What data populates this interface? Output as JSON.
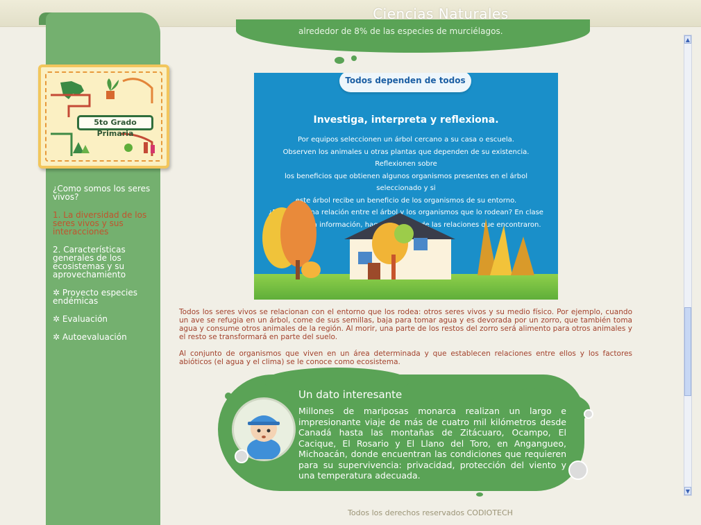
{
  "app_title": "Ciencias Naturales",
  "logo": {
    "label": "5to Grado Primaria",
    "icon": "mexico-map-icon"
  },
  "sidebar": {
    "items": [
      {
        "label": "¿Como somos los seres vivos?",
        "bullet": ""
      },
      {
        "label": "1. La diversidad de los seres vivos y sus interacciones",
        "bullet": "",
        "active": true
      },
      {
        "label": "2. Características generales de los ecosistemas y su aprovechamiento",
        "bullet": ""
      },
      {
        "label": "Proyecto especies endémicas",
        "bullet": "✲"
      },
      {
        "label": "Evaluación",
        "bullet": "✲"
      },
      {
        "label": "Autoevaluación",
        "bullet": "✲"
      }
    ]
  },
  "top_cloud_text": "alrededor de 8% de las especies de murciélagos.",
  "panel": {
    "badge": "Todos dependen de todos",
    "heading": "Investiga, interpreta y reflexiona.",
    "lines": [
      "Por equipos seleccionen un árbol cercano a su casa o escuela.",
      "Observen los animales u otras plantas que dependen de su existencia. Reflexionen sobre",
      "los beneficios que obtienen algunos organismos presentes en el árbol seleccionado y si",
      "este árbol recibe un beneficio de los organismos de su entorno.",
      "¿Existe alguna relación entre el árbol y los organismos que lo rodean? En clase",
      "comparten la información, hagan una lista de las relaciones que encontraron."
    ]
  },
  "intro": {
    "p1": "Todos los seres vivos se relacionan con el entorno que los rodea: otros seres vivos y su medio físico. Por ejemplo, cuando un ave se refugia en un árbol, come de sus semillas, baja para tomar agua y es devorada por un zorro, que también toma agua y consume otros animales de la región. Al morir, una parte de los restos del zorro será alimento para otros animales y el resto se transformará en parte del suelo.",
    "p2": "Al conjunto de organismos que viven en un área determinada y que establecen relaciones entre ellos y los factores abióticos (el agua y el clima) se le conoce como ecosistema."
  },
  "fact": {
    "title": "Un dato interesante",
    "body": "Millones de mariposas monarca realizan un largo e impresionante viaje de más de cuatro mil kilómetros desde Canadá hasta las montañas de Zitácuaro, Ocampo, El Cacique, El Rosario y El Llano del Toro, en Angangueo, Michoacán, donde encuentran las condiciones que requieren para su supervivencia: privacidad, protección del viento y una temperatura adecuada."
  },
  "footer": "Todos los derechos reservados CODIOTECH",
  "colors": {
    "sidebar": "#74b06f",
    "cloud": "#5aa356",
    "panel": "#1a8fc9",
    "text_brown": "#a2412c",
    "active_nav": "#c2532d"
  }
}
